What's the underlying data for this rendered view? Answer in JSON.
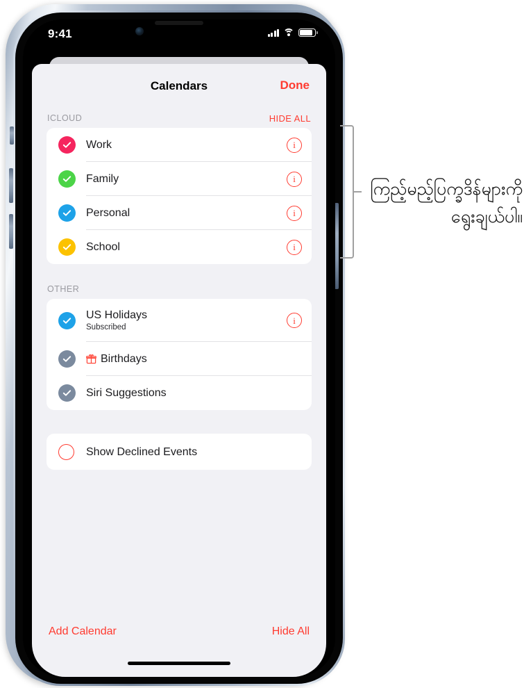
{
  "status_bar": {
    "time": "9:41",
    "signal_icon": "cellular-signal-icon",
    "wifi_icon": "wifi-icon",
    "battery_icon": "battery-icon"
  },
  "sheet": {
    "title": "Calendars",
    "done_label": "Done"
  },
  "sections": [
    {
      "header": "ICLOUD",
      "action": "HIDE ALL",
      "rows": [
        {
          "title": "Work",
          "subtitle": "",
          "check_color": "#f5255e",
          "checked": true,
          "info": true,
          "icon": ""
        },
        {
          "title": "Family",
          "subtitle": "",
          "check_color": "#4cd448",
          "checked": true,
          "info": true,
          "icon": ""
        },
        {
          "title": "Personal",
          "subtitle": "",
          "check_color": "#1ea2e8",
          "checked": true,
          "info": true,
          "icon": ""
        },
        {
          "title": "School",
          "subtitle": "",
          "check_color": "#fcc200",
          "checked": true,
          "info": true,
          "icon": ""
        }
      ]
    },
    {
      "header": "OTHER",
      "action": "",
      "rows": [
        {
          "title": "US Holidays",
          "subtitle": "Subscribed",
          "check_color": "#1ea2e8",
          "checked": true,
          "info": true,
          "icon": ""
        },
        {
          "title": "Birthdays",
          "subtitle": "",
          "check_color": "#7b8a9e",
          "checked": true,
          "info": false,
          "icon": "gift-icon"
        },
        {
          "title": "Siri Suggestions",
          "subtitle": "",
          "check_color": "#7b8a9e",
          "checked": true,
          "info": false,
          "icon": ""
        }
      ]
    },
    {
      "header": "",
      "action": "",
      "rows": [
        {
          "title": "Show Declined Events",
          "subtitle": "",
          "check_color": "#ff3b30",
          "checked": false,
          "info": false,
          "icon": ""
        }
      ]
    }
  ],
  "bottom_bar": {
    "add_calendar_label": "Add Calendar",
    "hide_all_label": "Hide All"
  },
  "callout": {
    "text": "ကြည့်မည့်ပြက္ခဒိန်များကိုရွေးချယ်ပါ။"
  },
  "colors": {
    "accent_red": "#ff3b30",
    "sheet_background": "#f1f1f5",
    "card_background": "#ffffff",
    "divider": "#e2e2e5",
    "section_label": "#9a9aa0",
    "callout_gray": "#a0a0a0"
  }
}
